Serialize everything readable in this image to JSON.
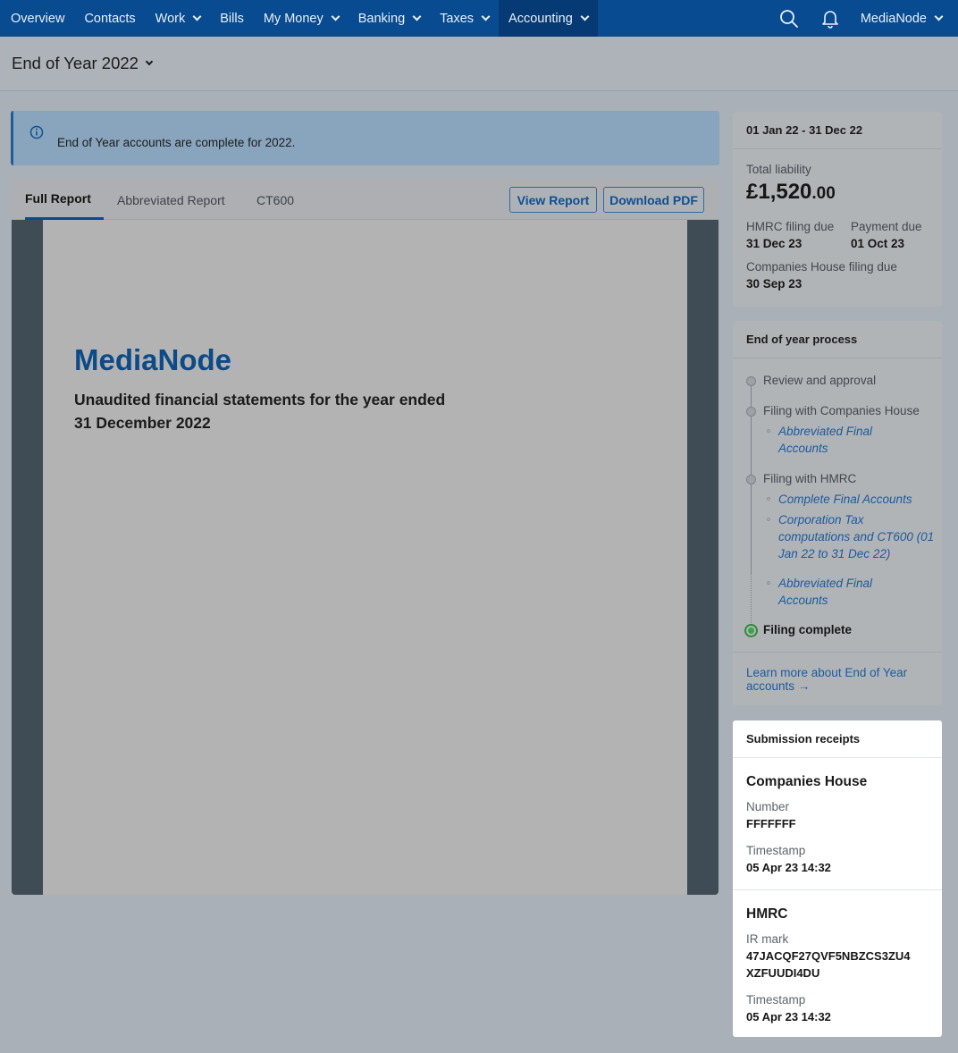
{
  "nav": {
    "items": [
      {
        "label": "Overview",
        "dropdown": false
      },
      {
        "label": "Contacts",
        "dropdown": false
      },
      {
        "label": "Work",
        "dropdown": true
      },
      {
        "label": "Bills",
        "dropdown": false
      },
      {
        "label": "My Money",
        "dropdown": true
      },
      {
        "label": "Banking",
        "dropdown": true
      },
      {
        "label": "Taxes",
        "dropdown": true
      },
      {
        "label": "Accounting",
        "dropdown": true,
        "active": true
      }
    ],
    "account_label": "MediaNode",
    "icons": [
      "search-icon",
      "bell-icon"
    ]
  },
  "page": {
    "title": "End of Year 2022"
  },
  "banner": {
    "icon": "info-icon",
    "text": "End of Year accounts are complete for 2022."
  },
  "report": {
    "tabs": [
      "Full Report",
      "Abbreviated Report",
      "CT600"
    ],
    "active_tab": "Full Report",
    "view_button": "View Report",
    "download_button": "Download PDF",
    "company": "MediaNode",
    "subtitle": "Unaudited financial statements for the year ended 31 December 2022"
  },
  "summary": {
    "period": "01 Jan 22 - 31 Dec 22",
    "total_liability_label": "Total liability",
    "total_liability_main": "£1,520",
    "total_liability_pence": ".00",
    "hmrc_due_label": "HMRC filing due",
    "hmrc_due_value": "31 Dec 23",
    "payment_due_label": "Payment due",
    "payment_due_value": "01 Oct 23",
    "ch_due_label": "Companies House filing due",
    "ch_due_value": "30 Sep 23"
  },
  "process": {
    "title": "End of year process",
    "review": "Review and approval",
    "companies_house": "Filing with Companies House",
    "ch_link": "Abbreviated Final Accounts",
    "hmrc": "Filing with HMRC",
    "hmrc_links": [
      "Complete Final Accounts",
      "Corporation Tax computations and CT600 (01 Jan 22 to 31 Dec 22)",
      "Abbreviated Final Accounts"
    ],
    "complete": "Filing complete",
    "learn_more": "Learn more about End of Year accounts →"
  },
  "receipts": {
    "title": "Submission receipts",
    "companies_house": {
      "title": "Companies House",
      "number_label": "Number",
      "number": "FFFFFFF",
      "timestamp_label": "Timestamp",
      "timestamp": "05 Apr 23 14:32"
    },
    "hmrc": {
      "title": "HMRC",
      "ir_label": "IR mark",
      "ir_mark_line1": "47JACQF27QVF5NBZCS3ZU4",
      "ir_mark_line2": "XZFUUDI4DU",
      "timestamp_label": "Timestamp",
      "timestamp": "05 Apr 23 14:32"
    }
  },
  "colors": {
    "nav": "#084b91",
    "accent": "#1a5a9e",
    "success": "#3aa34a"
  }
}
